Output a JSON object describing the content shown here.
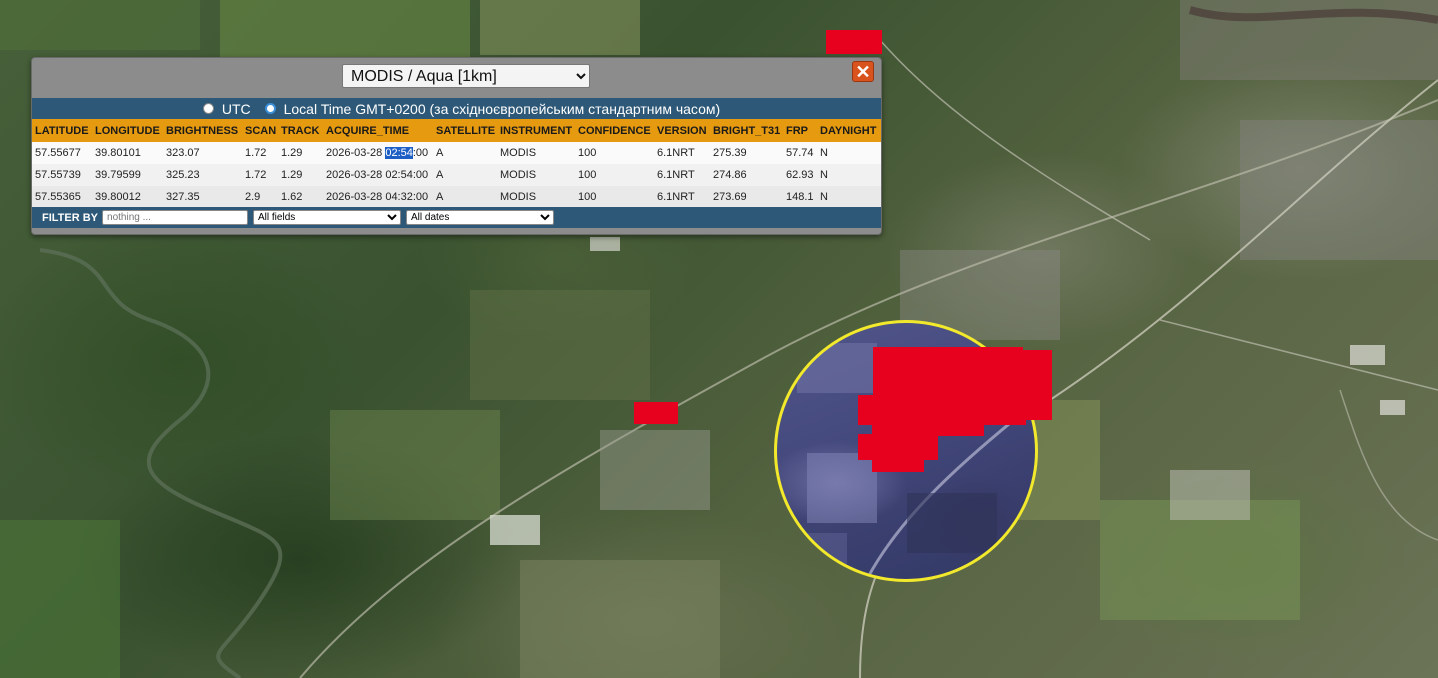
{
  "source_select": {
    "selected": "MODIS / Aqua [1km]"
  },
  "close_button": {
    "label": "✕"
  },
  "time_mode": {
    "utc_label": "UTC",
    "local_label": "Local Time GMT+0200 (за східноєвропейським стандартним часом)",
    "selected": "local"
  },
  "table": {
    "columns": [
      "LATITUDE",
      "LONGITUDE",
      "BRIGHTNESS",
      "SCAN",
      "TRACK",
      "ACQUIRE_TIME",
      "SATELLITE",
      "INSTRUMENT",
      "CONFIDENCE",
      "VERSION",
      "BRIGHT_T31",
      "FRP",
      "DAYNIGHT"
    ],
    "rows": [
      {
        "latitude": "57.55677",
        "longitude": "39.80101",
        "brightness": "323.07",
        "scan": "1.72",
        "track": "1.29",
        "acquire_date": "2026-03-28 ",
        "acquire_highlight": "02:54",
        "acquire_rest": ":00",
        "satellite": "A",
        "instrument": "MODIS",
        "confidence": "100",
        "version": "6.1NRT",
        "bright_t31": "275.39",
        "frp": "57.74",
        "daynight": "N"
      },
      {
        "latitude": "57.55739",
        "longitude": "39.79599",
        "brightness": "325.23",
        "scan": "1.72",
        "track": "1.29",
        "acquire_date": "2026-03-28 02:54:00",
        "acquire_highlight": "",
        "acquire_rest": "",
        "satellite": "A",
        "instrument": "MODIS",
        "confidence": "100",
        "version": "6.1NRT",
        "bright_t31": "274.86",
        "frp": "62.93",
        "daynight": "N"
      },
      {
        "latitude": "57.55365",
        "longitude": "39.80012",
        "brightness": "327.35",
        "scan": "2.9",
        "track": "1.62",
        "acquire_date": "2026-03-28 04:32:00",
        "acquire_highlight": "",
        "acquire_rest": "",
        "satellite": "A",
        "instrument": "MODIS",
        "confidence": "100",
        "version": "6.1NRT",
        "bright_t31": "273.69",
        "frp": "148.1",
        "daynight": "N"
      }
    ]
  },
  "filter": {
    "label": "FILTER BY",
    "placeholder": "nothing ...",
    "field_selected": "All fields",
    "date_selected": "All dates"
  },
  "colors": {
    "hotspot": "#e8001f",
    "highlight_ring": "#f2e92c",
    "header_bar": "#2d5878",
    "table_header": "#e69a10",
    "close": "#d9531e"
  },
  "icons": [
    "close-icon",
    "radio-icon",
    "chevron-down-icon"
  ]
}
